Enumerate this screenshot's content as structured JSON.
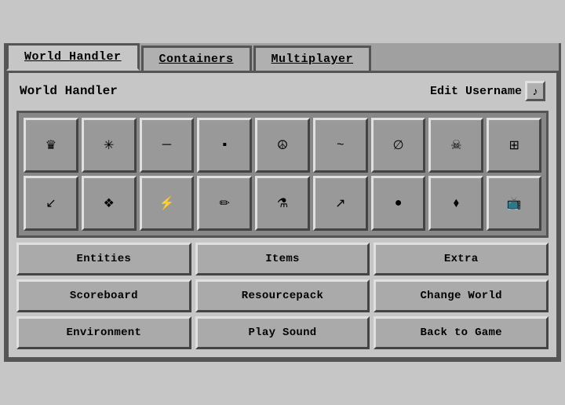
{
  "tabs": [
    {
      "label": "World Handler",
      "active": true
    },
    {
      "label": "Containers",
      "active": false
    },
    {
      "label": "Multiplayer",
      "active": false
    }
  ],
  "header": {
    "title": "World Handler",
    "edit_username_label": "Edit Username",
    "edit_username_icon": "♪"
  },
  "icon_rows": [
    [
      {
        "icon": "♛",
        "name": "crown-icon"
      },
      {
        "icon": "✳",
        "name": "sparkle-icon"
      },
      {
        "icon": "─",
        "name": "dash-icon"
      },
      {
        "icon": "▪",
        "name": "square-icon"
      },
      {
        "icon": "☮",
        "name": "peace-icon"
      },
      {
        "icon": "~",
        "name": "tilde-icon"
      },
      {
        "icon": "∅",
        "name": "empty-icon"
      },
      {
        "icon": "☠",
        "name": "skull-icon"
      },
      {
        "icon": "⊞",
        "name": "grid-icon"
      }
    ],
    [
      {
        "icon": "↙",
        "name": "arrow-dl-icon"
      },
      {
        "icon": "❖",
        "name": "diamond4-icon"
      },
      {
        "icon": "⚡",
        "name": "lightning-icon"
      },
      {
        "icon": "✏",
        "name": "pencil-icon"
      },
      {
        "icon": "⚗",
        "name": "flask-icon"
      },
      {
        "icon": "↗",
        "name": "arrow-ur-icon"
      },
      {
        "icon": "●",
        "name": "circle-icon"
      },
      {
        "icon": "⬧",
        "name": "diamond-icon"
      },
      {
        "icon": "📺",
        "name": "tv-icon"
      }
    ]
  ],
  "action_buttons": [
    {
      "label": "Entities",
      "name": "entities-button"
    },
    {
      "label": "Items",
      "name": "items-button"
    },
    {
      "label": "Extra",
      "name": "extra-button"
    },
    {
      "label": "Scoreboard",
      "name": "scoreboard-button"
    },
    {
      "label": "Resourcepack",
      "name": "resourcepack-button"
    },
    {
      "label": "Change World",
      "name": "change-world-button"
    },
    {
      "label": "Environment",
      "name": "environment-button"
    },
    {
      "label": "Play Sound",
      "name": "play-sound-button"
    },
    {
      "label": "Back to Game",
      "name": "back-to-game-button"
    }
  ]
}
